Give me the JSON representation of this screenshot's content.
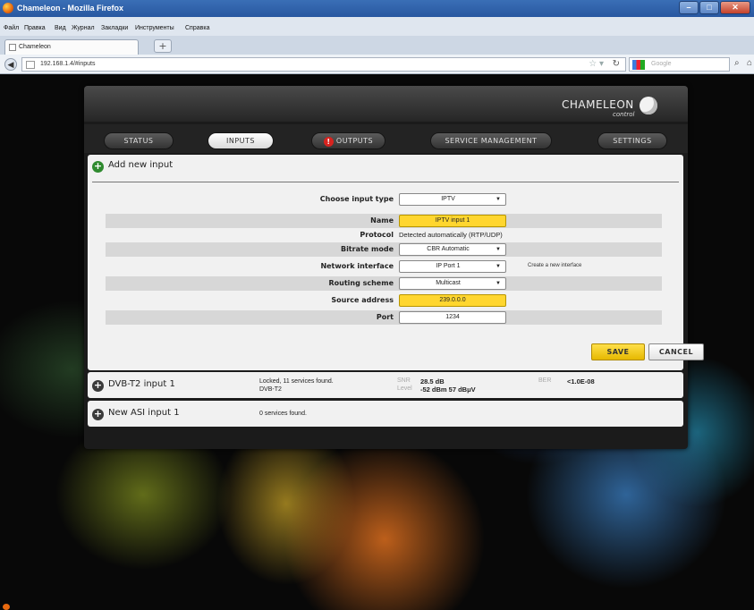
{
  "browser": {
    "window_title": "Chameleon - Mozilla Firefox",
    "menu": [
      "Файл",
      "Правка",
      "Вид",
      "Журнал",
      "Закладки",
      "Инструменты",
      "Справка"
    ],
    "tab_title": "Chameleon",
    "new_tab": "+",
    "url": "192.168.1.4/#inputs",
    "search_engine_placeholder": "Google",
    "window_controls": [
      "–",
      "□",
      "✕"
    ]
  },
  "logo": {
    "word": "CHAMELEON",
    "tagline": "control"
  },
  "nav_tabs": [
    {
      "label": "STATUS",
      "active": false
    },
    {
      "label": "INPUTS",
      "active": true
    },
    {
      "label": "OUTPUTS",
      "active": false,
      "alert": "!"
    },
    {
      "label": "SERVICE MANAGEMENT",
      "active": false
    },
    {
      "label": "SETTINGS",
      "active": false
    }
  ],
  "add_input": {
    "title": "Add new input",
    "plus_icon": "+",
    "fields": {
      "input_type": {
        "label": "Choose input type",
        "value": "IPTV"
      },
      "name": {
        "label": "Name",
        "value": "IPTV input 1"
      },
      "protocol": {
        "label": "Protocol",
        "value": "Detected automatically (RTP/UDP)"
      },
      "bitrate_mode": {
        "label": "Bitrate mode",
        "value": "CBR Automatic"
      },
      "network_interface": {
        "label": "Network interface",
        "value": "IP Port 1",
        "extra": "Create a new interface"
      },
      "routing_scheme": {
        "label": "Routing scheme",
        "value": "Multicast"
      },
      "source_address": {
        "label": "Source address",
        "value": "239.0.0.0"
      },
      "port": {
        "label": "Port",
        "value": "1234"
      }
    },
    "save_label": "SAVE",
    "cancel_label": "CANCEL",
    "dropdown_arrow": "▼"
  },
  "inputs": [
    {
      "name": "DVB-T2 input 1",
      "status_line1": "Locked, 11 services found.",
      "status_line2": "DVB-T2",
      "snr_label": "SNR",
      "snr_value": "28.5 dB",
      "level_label": "Level",
      "level_value": "-52 dBm 57 dBμV",
      "ber_label": "BER",
      "ber_value": "<1.0E-08"
    },
    {
      "name": "New ASI input 1",
      "status_line1": "0 services found."
    }
  ],
  "colors": {
    "accent_yellow": "#ffd62f",
    "add_green": "#2f8a2f",
    "alert_red": "#d7231f"
  }
}
